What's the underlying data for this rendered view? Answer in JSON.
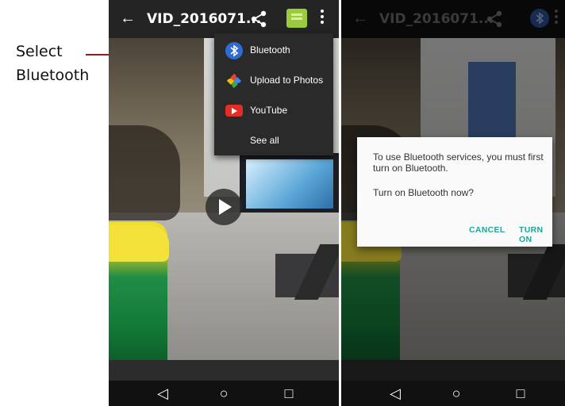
{
  "annotation": {
    "line1": "Select",
    "line2": "Bluetooth",
    "line_color": "#8a1f1f"
  },
  "phone1": {
    "toolbar": {
      "back_icon": "arrow-back-icon",
      "title": "VID_2016071...",
      "share_icon": "share-icon",
      "message_icon": "message-icon",
      "more_icon": "more-vert-icon"
    },
    "share_menu": {
      "items": [
        {
          "label": "Bluetooth",
          "icon": "bluetooth-icon"
        },
        {
          "label": "Upload to Photos",
          "icon": "google-photos-icon"
        },
        {
          "label": "YouTube",
          "icon": "youtube-icon"
        },
        {
          "label": "See all",
          "icon": ""
        }
      ]
    },
    "play_icon": "play-icon",
    "nav": {
      "back": "◁",
      "home": "○",
      "recent": "□"
    }
  },
  "phone2": {
    "toolbar": {
      "title": "VID_2016071...",
      "bluetooth_icon": "bluetooth-icon"
    },
    "dialog": {
      "message": "To use Bluetooth services, you must first turn on Bluetooth.",
      "question": "Turn on Bluetooth now?",
      "cancel_label": "CANCEL",
      "turn_on_label": "TURN ON",
      "accent_color": "#1aa89a"
    },
    "nav": {
      "back": "◁",
      "home": "○",
      "recent": "□"
    }
  }
}
